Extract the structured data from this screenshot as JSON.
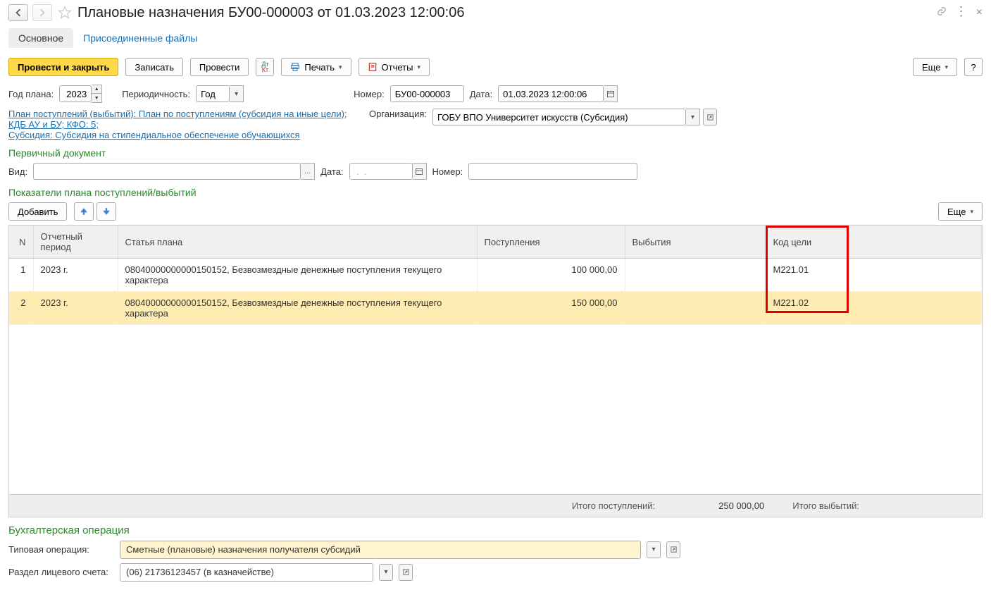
{
  "header": {
    "title": "Плановые назначения БУ00-000003 от 01.03.2023 12:00:06"
  },
  "tabs": {
    "main": "Основное",
    "attached": "Присоединенные файлы"
  },
  "toolbar": {
    "post_close": "Провести и закрыть",
    "save": "Записать",
    "post": "Провести",
    "print": "Печать",
    "reports": "Отчеты",
    "more": "Еще"
  },
  "fields": {
    "year_label": "Год плана:",
    "year_value": "2023",
    "periodicity_label": "Периодичность:",
    "periodicity_value": "Год",
    "number_label": "Номер:",
    "number_value": "БУ00-000003",
    "date_label": "Дата:",
    "date_value": "01.03.2023 12:00:06",
    "org_label": "Организация:",
    "org_value": "ГОБУ ВПО Университет искусств (Субсидия)",
    "link1": "План поступлений (выбытий): План по поступлениям (субсидия на иные цели); КДБ АУ и БУ; КФО: 5;",
    "link2": "Субсидия: Субсидия на стипендиальное обеспечение обучающихся"
  },
  "primary_doc": {
    "title": "Первичный документ",
    "kind_label": "Вид:",
    "date_label": "Дата:",
    "date_value": " .  .    ",
    "number_label": "Номер:"
  },
  "indicators": {
    "title": "Показатели плана поступлений/выбытий",
    "add": "Добавить",
    "more": "Еще",
    "cols": {
      "n": "N",
      "period": "Отчетный период",
      "article": "Статья плана",
      "in": "Поступления",
      "out": "Выбытия",
      "goal": "Код цели"
    },
    "rows": [
      {
        "n": "1",
        "period": "2023 г.",
        "article": "08040000000000150152, Безвозмездные денежные поступления текущего характера",
        "in": "100 000,00",
        "out": "",
        "goal": "М221.01"
      },
      {
        "n": "2",
        "period": "2023 г.",
        "article": "08040000000000150152, Безвозмездные денежные поступления текущего характера",
        "in": "150 000,00",
        "out": "",
        "goal": "М221.02"
      }
    ],
    "totals": {
      "in_label": "Итого поступлений:",
      "in_value": "250 000,00",
      "out_label": "Итого выбытий:",
      "out_value": ""
    }
  },
  "accounting": {
    "title": "Бухгалтерская операция",
    "typ_op_label": "Типовая операция:",
    "typ_op_value": "Сметные (плановые) назначения получателя субсидий",
    "acct_label": "Раздел лицевого счета:",
    "acct_value": "(06) 21736123457 (в казначействе)"
  }
}
